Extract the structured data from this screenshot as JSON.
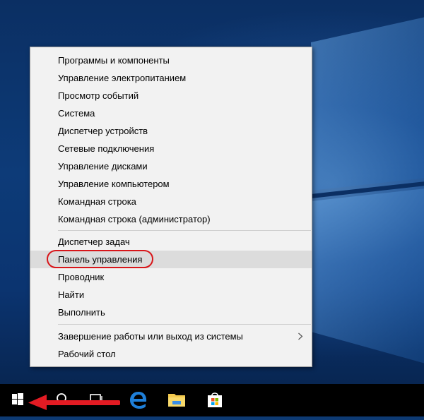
{
  "menu": {
    "group1": [
      "Программы и компоненты",
      "Управление электропитанием",
      "Просмотр событий",
      "Система",
      "Диспетчер устройств",
      "Сетевые подключения",
      "Управление дисками",
      "Управление компьютером",
      "Командная строка",
      "Командная строка (администратор)"
    ],
    "group2": [
      "Диспетчер задач",
      "Панель управления",
      "Проводник",
      "Найти",
      "Выполнить"
    ],
    "group3": [
      "Завершение работы или выход из системы",
      "Рабочий стол"
    ],
    "highlighted_item": "Панель управления"
  },
  "taskbar": {
    "icons": [
      "windows-start-icon",
      "search-icon",
      "task-view-icon",
      "edge-icon",
      "file-explorer-icon",
      "store-icon"
    ]
  },
  "annotations": {
    "oval_color": "#d8161a",
    "arrow_color": "#e31b23"
  }
}
